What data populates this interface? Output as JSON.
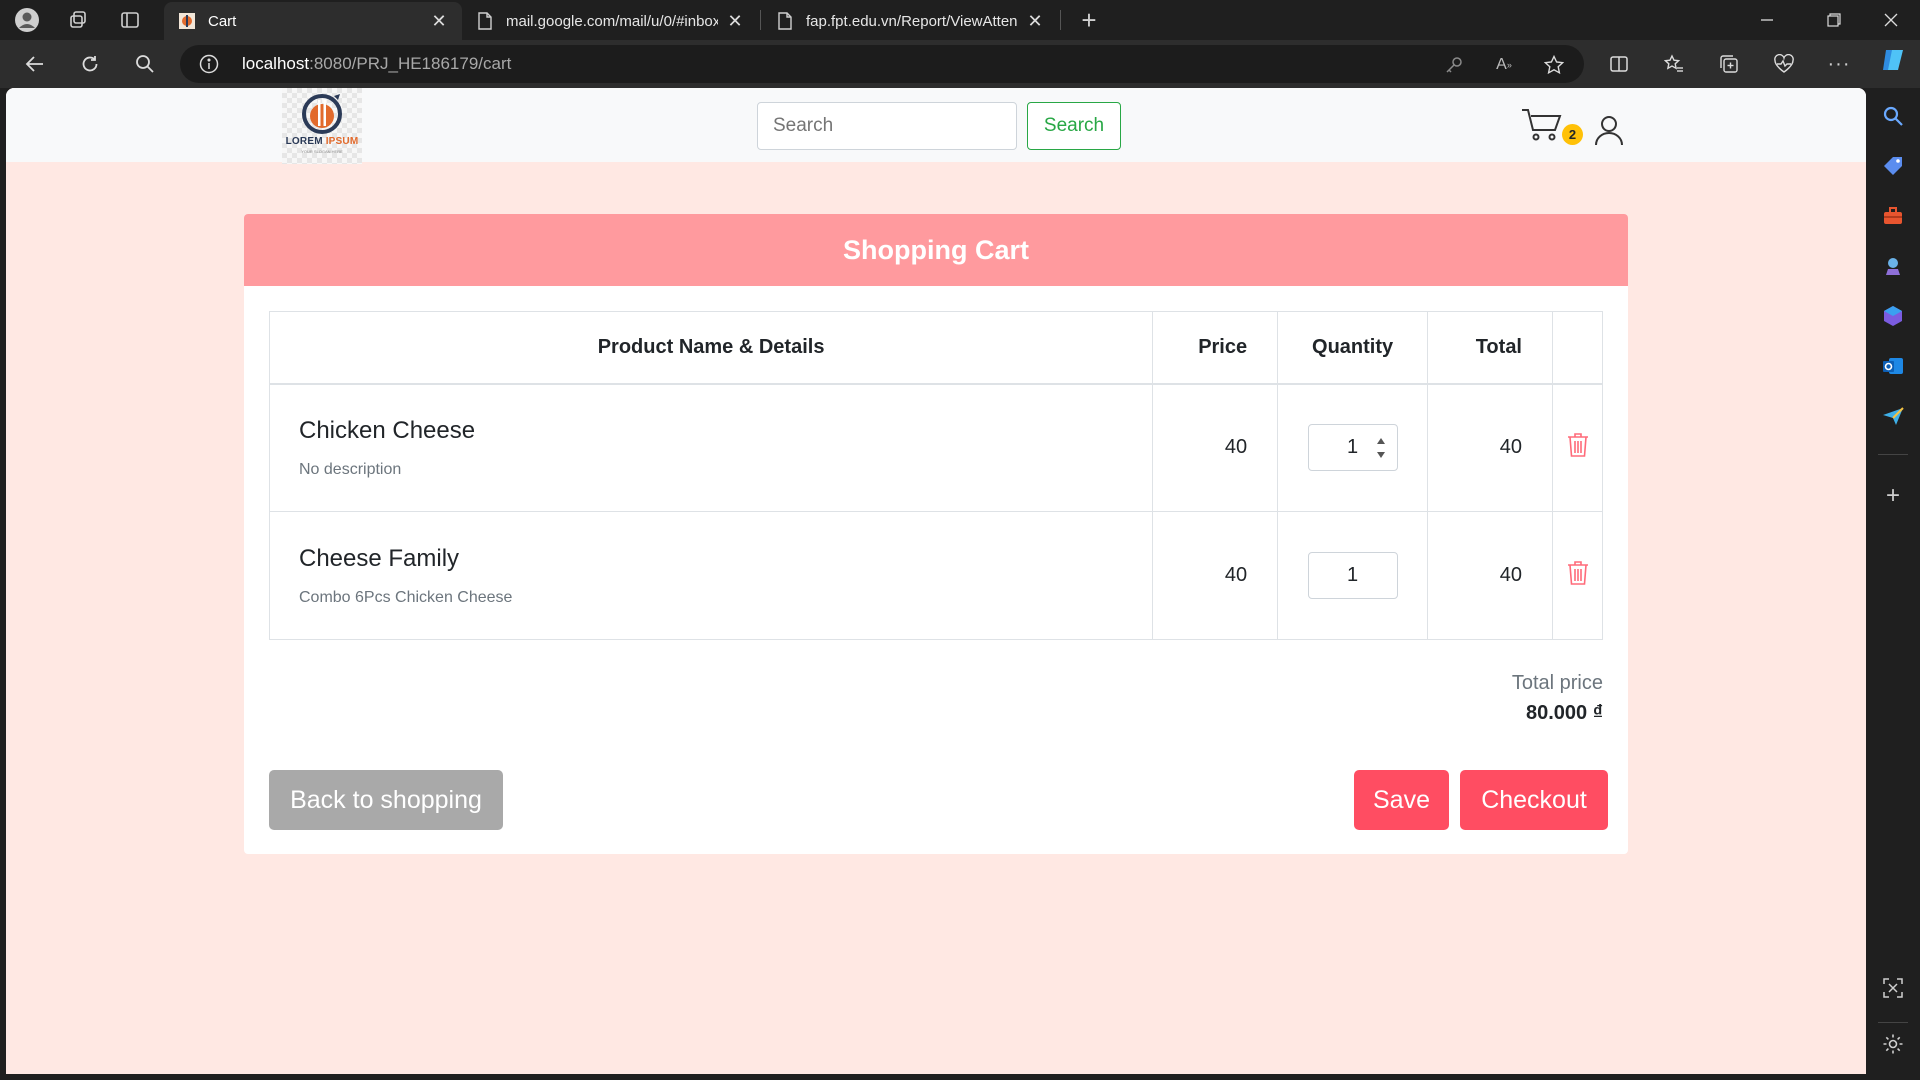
{
  "browser": {
    "tabs": [
      {
        "title": "Cart",
        "active": true
      },
      {
        "title": "mail.google.com/mail/u/0/#inbox",
        "active": false
      },
      {
        "title": "fap.fpt.edu.vn/Report/ViewAttendance",
        "active": false
      }
    ],
    "url_host": "localhost",
    "url_rest": ":8080/PRJ_HE186179/cart"
  },
  "header": {
    "logo_line1": "LOREM",
    "logo_line2": "IPSUM",
    "logo_tagline": "YOUR SLOGAN HERE",
    "search_placeholder": "Search",
    "search_button": "Search",
    "cart_count": "2"
  },
  "cart": {
    "title": "Shopping Cart",
    "columns": [
      "Product Name & Details",
      "Price",
      "Quantity",
      "Total"
    ],
    "items": [
      {
        "name": "Chicken Cheese",
        "description": "No description",
        "price": "40",
        "quantity": "1",
        "total": "40"
      },
      {
        "name": "Cheese Family",
        "description": "Combo 6Pcs Chicken Cheese",
        "price": "40",
        "quantity": "1",
        "total": "40"
      }
    ],
    "total_label": "Total price",
    "total_value": "80.000 ₫",
    "back_button": "Back to shopping",
    "save_button": "Save",
    "checkout_button": "Checkout"
  },
  "colors": {
    "page_bg": "#ffe8e3",
    "card_header": "#ff9a9e",
    "primary_button": "#ff4d62",
    "secondary_button": "#a9a9a9",
    "search_green": "#28a745",
    "badge": "#ffc107"
  }
}
